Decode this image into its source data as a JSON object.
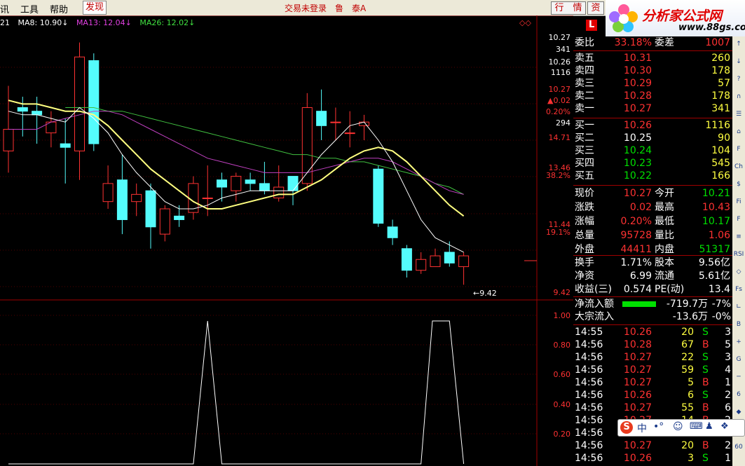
{
  "menu": {
    "items": [
      "讯",
      "工具",
      "帮助"
    ],
    "discover": "发现",
    "trade_status": "交易未登录",
    "stock_name": "鲁　泰A",
    "btn_quote": "行　情",
    "btn_info": "资"
  },
  "logo": {
    "text": "分析家公式网",
    "url": "www.88gs.com"
  },
  "ma_legend": {
    "prefix": "21",
    "ma8": "MA8: 10.90↓",
    "ma13": "MA13: 12.04↓",
    "ma26": "MA26: 12.02↓"
  },
  "colors": {
    "up": "#ff3232",
    "down": "#54fcfc",
    "ma8": "#ffffff",
    "ma13": "#ffff80",
    "ma26_purple": "#c040c0",
    "ma26_green": "#40c040",
    "grid": "#a00000",
    "axis_text": "#ff3232"
  },
  "price_axis": {
    "labels": [
      {
        "t": "10.27",
        "c": "#ffffff"
      },
      {
        "t": "341",
        "c": "#ffffff"
      },
      {
        "t": "10.26",
        "c": "#ffffff"
      },
      {
        "t": "1116",
        "c": "#ffffff"
      },
      {
        "t": "10.27",
        "c": "#ff3232"
      },
      {
        "t": "▲0.02",
        "c": "#ff3232"
      },
      {
        "t": "0.20%",
        "c": "#ff3232"
      },
      {
        "t": "294",
        "c": "#ffffff"
      },
      {
        "t": "14.71",
        "c": "#ff3232"
      },
      {
        "t": "13.46",
        "c": "#ff3232"
      },
      {
        "t": "38.2%",
        "c": "#ff3232"
      },
      {
        "t": "11.44",
        "c": "#ff3232"
      },
      {
        "t": "19.1%",
        "c": "#ff3232"
      },
      {
        "t": "9.42",
        "c": "#ff3232"
      }
    ],
    "low_marker": "9.42"
  },
  "indicator_axis": {
    "labels": [
      "1.00",
      "0.80",
      "0.60",
      "0.40",
      "0.20"
    ]
  },
  "chart_data": {
    "type": "candlestick",
    "candles": [
      {
        "o": 13.1,
        "c": 13.7,
        "h": 14.9,
        "l": 12.5
      },
      {
        "o": 14.3,
        "c": 14.2,
        "h": 14.6,
        "l": 13.5
      },
      {
        "o": 14.2,
        "c": 14.1,
        "h": 14.6,
        "l": 13.3
      },
      {
        "o": 13.6,
        "c": 13.9,
        "h": 14.2,
        "l": 13.2
      },
      {
        "o": 13.3,
        "c": 13.2,
        "h": 14.0,
        "l": 12.2
      },
      {
        "o": 13.1,
        "c": 15.7,
        "h": 16.1,
        "l": 12.3
      },
      {
        "o": 15.6,
        "c": 13.3,
        "h": 15.8,
        "l": 13.1
      },
      {
        "o": 11.7,
        "c": 12.2,
        "h": 12.7,
        "l": 11.5
      },
      {
        "o": 12.3,
        "c": 11.2,
        "h": 13.0,
        "l": 10.8
      },
      {
        "o": 11.7,
        "c": 11.9,
        "h": 12.2,
        "l": 11.3
      },
      {
        "o": 12.0,
        "c": 11.0,
        "h": 12.2,
        "l": 10.4
      },
      {
        "o": 10.8,
        "c": 11.5,
        "h": 11.6,
        "l": 10.6
      },
      {
        "o": 11.3,
        "c": 11.2,
        "h": 11.6,
        "l": 11.0
      },
      {
        "o": 11.4,
        "c": 12.2,
        "h": 12.4,
        "l": 11.2
      },
      {
        "o": 11.8,
        "c": 11.8,
        "h": 12.7,
        "l": 11.3
      },
      {
        "o": 12.3,
        "c": 12.1,
        "h": 12.5,
        "l": 11.7
      },
      {
        "o": 12.0,
        "c": 12.4,
        "h": 12.5,
        "l": 11.7
      },
      {
        "o": 12.3,
        "c": 12.2,
        "h": 12.5,
        "l": 12.0
      },
      {
        "o": 12.2,
        "c": 12.0,
        "h": 12.8,
        "l": 11.9
      },
      {
        "o": 11.8,
        "c": 12.1,
        "h": 12.7,
        "l": 11.7
      },
      {
        "o": 12.4,
        "c": 12.0,
        "h": 12.4,
        "l": 11.6
      },
      {
        "o": 12.2,
        "c": 14.3,
        "h": 14.7,
        "l": 12.0
      },
      {
        "o": 14.2,
        "c": 13.8,
        "h": 14.8,
        "l": 13.4
      },
      {
        "o": 13.9,
        "c": 13.9,
        "h": 14.3,
        "l": 13.4
      },
      {
        "o": 13.6,
        "c": 13.6,
        "h": 14.2,
        "l": 13.2
      },
      {
        "o": 13.8,
        "c": 13.9,
        "h": 14.1,
        "l": 13.4
      },
      {
        "o": 12.6,
        "c": 11.1,
        "h": 12.7,
        "l": 11.0
      },
      {
        "o": 11.0,
        "c": 10.7,
        "h": 11.2,
        "l": 10.5
      },
      {
        "o": 10.4,
        "c": 9.8,
        "h": 10.5,
        "l": 9.6
      },
      {
        "o": 9.8,
        "c": 10.1,
        "h": 10.3,
        "l": 9.7
      },
      {
        "o": 9.9,
        "c": 10.2,
        "h": 10.4,
        "l": 9.9
      },
      {
        "o": 10.3,
        "c": 10.0,
        "h": 10.6,
        "l": 9.9
      },
      {
        "o": 9.9,
        "c": 10.2,
        "h": 10.3,
        "l": 9.4
      }
    ],
    "ma8": [
      14.2,
      14.1,
      14.1,
      14.0,
      13.9,
      14.3,
      14.0,
      13.6,
      13.0,
      12.5,
      12.1,
      11.7,
      11.5,
      11.5,
      11.6,
      11.8,
      11.9,
      12.0,
      12.0,
      12.0,
      12.0,
      12.5,
      13.0,
      13.4,
      13.8,
      13.9,
      13.4,
      12.8,
      12.0,
      11.2,
      10.7,
      10.5,
      10.3
    ],
    "ma13": [
      14.5,
      14.4,
      14.4,
      14.3,
      14.2,
      14.2,
      14.1,
      13.8,
      13.4,
      13.0,
      12.6,
      12.3,
      12.0,
      11.7,
      11.5,
      11.5,
      11.6,
      11.7,
      11.8,
      11.9,
      11.9,
      12.1,
      12.3,
      12.6,
      12.9,
      13.1,
      13.2,
      13.1,
      12.8,
      12.4,
      12.0,
      11.6,
      11.3
    ],
    "ma26_purple": [
      13.7,
      13.7,
      13.7,
      13.9,
      14.0,
      14.1,
      14.2,
      14.2,
      14.1,
      13.9,
      13.7,
      13.5,
      13.3,
      13.1,
      12.9,
      12.8,
      12.7,
      12.6,
      12.5,
      12.5,
      12.5,
      12.5,
      12.6,
      12.7,
      12.8,
      12.9,
      12.9,
      12.8,
      12.6,
      12.4,
      12.2,
      12.0,
      11.9
    ],
    "ma26_green": [
      null,
      null,
      null,
      null,
      14.3,
      14.3,
      14.3,
      14.2,
      14.2,
      14.1,
      14.0,
      13.9,
      13.8,
      13.7,
      13.6,
      13.5,
      13.4,
      13.3,
      13.2,
      13.1,
      13.0,
      13.0,
      12.9,
      12.9,
      12.8,
      12.8,
      12.7,
      12.6,
      12.5,
      12.4,
      12.2,
      12.1,
      11.9
    ],
    "indicator": [
      0,
      0,
      0,
      0,
      0,
      0,
      0,
      0,
      0,
      0,
      0,
      0,
      0,
      0,
      1,
      0,
      0,
      0,
      0,
      0,
      0,
      0,
      0,
      0,
      0,
      0,
      0,
      0,
      0,
      0,
      1,
      1,
      0
    ],
    "ylim": [
      9.0,
      16.5
    ]
  },
  "quote": {
    "logo_letter": "L",
    "header_row": {
      "label": "委比",
      "value": "33.18%",
      "label2": "委差",
      "value2": "1007"
    },
    "sells": [
      {
        "label": "卖五",
        "price": "10.31",
        "vol": "260"
      },
      {
        "label": "卖四",
        "price": "10.30",
        "vol": "178"
      },
      {
        "label": "卖三",
        "price": "10.29",
        "vol": "57"
      },
      {
        "label": "卖二",
        "price": "10.28",
        "vol": "178"
      },
      {
        "label": "卖一",
        "price": "10.27",
        "vol": "341"
      }
    ],
    "buys": [
      {
        "label": "买一",
        "price": "10.26",
        "vol": "1116",
        "pc": "#ff3232"
      },
      {
        "label": "买二",
        "price": "10.25",
        "vol": "90",
        "pc": "#ffffff"
      },
      {
        "label": "买三",
        "price": "10.24",
        "vol": "104",
        "pc": "#00e000"
      },
      {
        "label": "买四",
        "price": "10.23",
        "vol": "545",
        "pc": "#00e000"
      },
      {
        "label": "买五",
        "price": "10.22",
        "vol": "166",
        "pc": "#00e000"
      }
    ],
    "stats": [
      {
        "l1": "现价",
        "v1": "10.27",
        "c1": "#ff3232",
        "l2": "今开",
        "v2": "10.21",
        "c2": "#00e000"
      },
      {
        "l1": "涨跌",
        "v1": "0.02",
        "c1": "#ff3232",
        "l2": "最高",
        "v2": "10.43",
        "c2": "#ff3232"
      },
      {
        "l1": "涨幅",
        "v1": "0.20%",
        "c1": "#ff3232",
        "l2": "最低",
        "v2": "10.17",
        "c2": "#00e000"
      },
      {
        "l1": "总量",
        "v1": "95728",
        "c1": "#ff3232",
        "l2": "量比",
        "v2": "1.06",
        "c2": "#ff3232"
      },
      {
        "l1": "外盘",
        "v1": "44411",
        "c1": "#ff3232",
        "l2": "内盘",
        "v2": "51317",
        "c2": "#00e000"
      }
    ],
    "stats2": [
      {
        "l1": "换手",
        "v1": "1.71%",
        "l2": "股本",
        "v2": "9.56亿"
      },
      {
        "l1": "净资",
        "v1": "6.99",
        "l2": "流通",
        "v2": "5.61亿"
      },
      {
        "l1": "收益(三)",
        "v1": "0.574",
        "l2": "PE(动)",
        "v2": "13.4"
      }
    ],
    "flows": [
      {
        "label": "净流入额",
        "amount": "-719.7万",
        "pct": "-7%",
        "bar": 1
      },
      {
        "label": "大宗流入",
        "amount": "-13.6万",
        "pct": "-0%",
        "bar": 0
      }
    ],
    "ticks": [
      {
        "t": "14:55",
        "p": "10.26",
        "v": "20",
        "s": "S",
        "n": "3"
      },
      {
        "t": "14:56",
        "p": "10.28",
        "v": "67",
        "s": "B",
        "n": "5"
      },
      {
        "t": "14:56",
        "p": "10.27",
        "v": "22",
        "s": "S",
        "n": "3"
      },
      {
        "t": "14:56",
        "p": "10.27",
        "v": "59",
        "s": "S",
        "n": "4"
      },
      {
        "t": "14:56",
        "p": "10.27",
        "v": "5",
        "s": "B",
        "n": "1"
      },
      {
        "t": "14:56",
        "p": "10.26",
        "v": "6",
        "s": "S",
        "n": "2"
      },
      {
        "t": "14:56",
        "p": "10.27",
        "v": "55",
        "s": "B",
        "n": "6"
      },
      {
        "t": "14:56",
        "p": "10.27",
        "v": "14",
        "s": "B",
        "n": "2"
      },
      {
        "t": "14:56",
        "p": "",
        "v": "",
        "s": "",
        "n": ""
      },
      {
        "t": "14:56",
        "p": "10.27",
        "v": "20",
        "s": "B",
        "n": "2"
      },
      {
        "t": "14:56",
        "p": "10.26",
        "v": "3",
        "s": "S",
        "n": "1"
      }
    ]
  },
  "ime": {
    "label": "中"
  },
  "side_tools": [
    "↑",
    "↓",
    "?",
    "∩",
    "☰",
    "⌂",
    "F",
    "Ch",
    "$",
    "Fi",
    "F",
    "≡",
    "RSI",
    "◇",
    "Fs",
    "∟",
    "B",
    "+",
    "G",
    "─",
    "6",
    "◆",
    "↔",
    "60"
  ]
}
